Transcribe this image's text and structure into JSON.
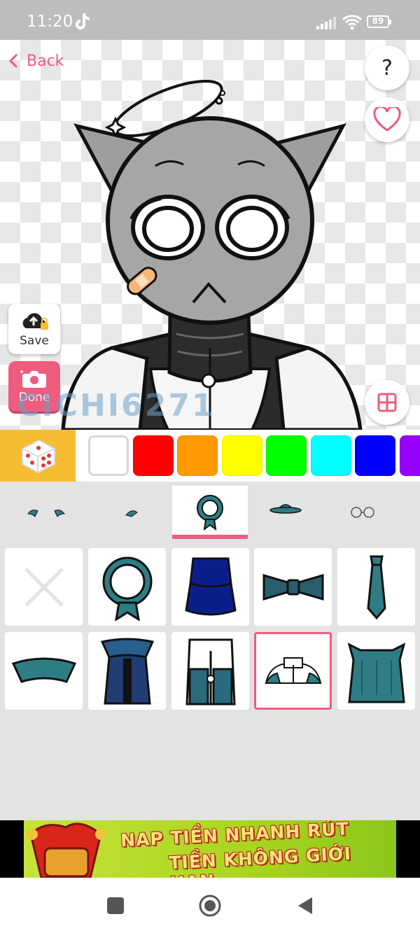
{
  "status_bar": {
    "time": "11:20",
    "battery": "89"
  },
  "header": {
    "back_label": "Back",
    "help_label": "?"
  },
  "canvas": {
    "watermark": "CICHI6271"
  },
  "actions": {
    "save_label": "Save",
    "done_label": "Done"
  },
  "palette": {
    "colors": [
      "#ffffff",
      "#ff0000",
      "#ff9900",
      "#ffff00",
      "#00ff00",
      "#00ffff",
      "#0000ff",
      "#9900ff"
    ],
    "selected_index": 0
  },
  "tabs": {
    "items": [
      "eyebrows",
      "accessory",
      "neck",
      "hat",
      "glasses"
    ],
    "active_index": 2
  },
  "items_grid": {
    "items": [
      "none",
      "ring-collar",
      "navy-layered-top",
      "bow-tie",
      "tie",
      "teal-collar",
      "navy-scarf",
      "zip-jacket",
      "white-teal-jacket",
      "teal-dress-top"
    ],
    "selected_index": 8
  },
  "ad": {
    "line1": "NAP TIỀN NHANH RÚT",
    "line2": "TIỀN KHÔNG GIỚI HẠN"
  },
  "colors": {
    "accent": "#ee5c7e",
    "dice_bg": "#f6bc32",
    "item_teal": "#2e7d84",
    "item_navy": "#0b1f8c"
  }
}
